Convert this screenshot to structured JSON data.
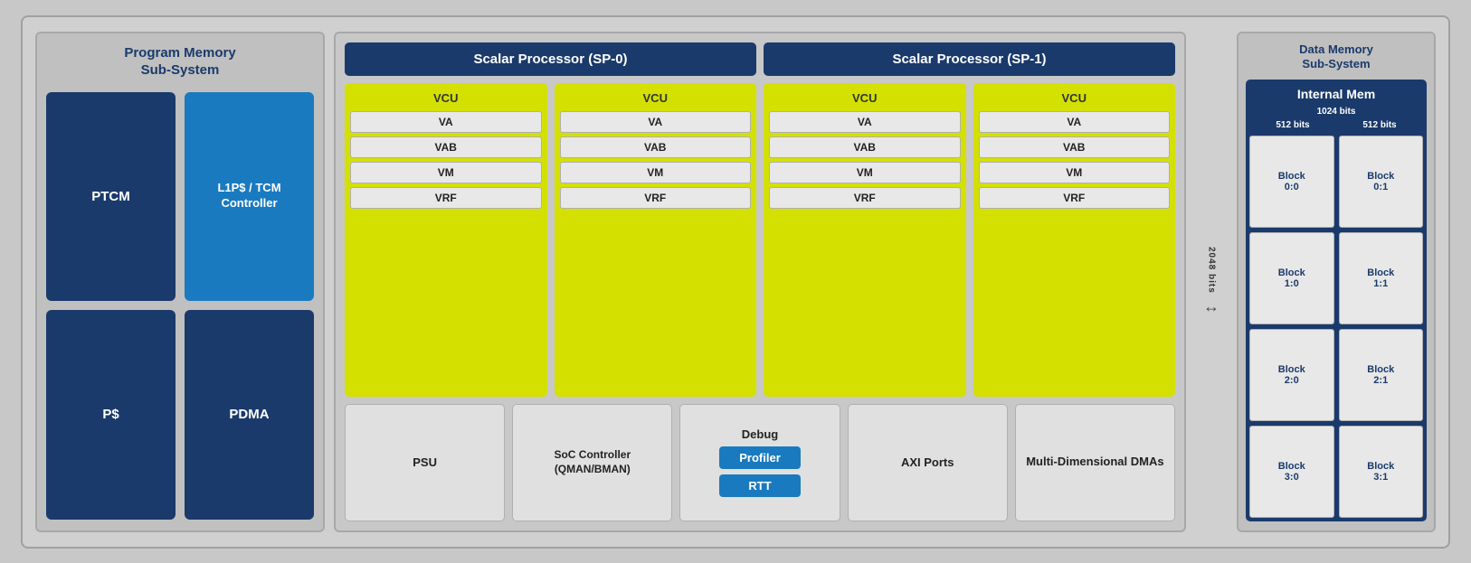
{
  "left": {
    "title": "Program Memory\nSub-System",
    "blocks": [
      {
        "id": "ptcm",
        "label": "PTCM",
        "style": "dark"
      },
      {
        "id": "l1p",
        "label": "L1P$ / TCM Controller",
        "style": "light"
      },
      {
        "id": "ps",
        "label": "P$",
        "style": "dark"
      },
      {
        "id": "pdma",
        "label": "PDMA",
        "style": "dark"
      }
    ]
  },
  "middle": {
    "sp_boxes": [
      {
        "id": "sp0",
        "label": "Scalar Processor (SP-0)"
      },
      {
        "id": "sp1",
        "label": "Scalar Processor (SP-1)"
      }
    ],
    "vcu_units": [
      {
        "id": "vcu1",
        "label": "VCU",
        "sub_blocks": [
          "VA",
          "VAB",
          "VM",
          "VRF"
        ]
      },
      {
        "id": "vcu2",
        "label": "VCU",
        "sub_blocks": [
          "VA",
          "VAB",
          "VM",
          "VRF"
        ]
      },
      {
        "id": "vcu3",
        "label": "VCU",
        "sub_blocks": [
          "VA",
          "VAB",
          "VM",
          "VRF"
        ]
      },
      {
        "id": "vcu4",
        "label": "VCU",
        "sub_blocks": [
          "VA",
          "VAB",
          "VM",
          "VRF"
        ]
      }
    ],
    "bottom_blocks": [
      {
        "id": "psu",
        "label": "PSU"
      },
      {
        "id": "soc",
        "label": "SoC Controller (QMAN/BMAN)"
      },
      {
        "id": "debug",
        "label": "Debug",
        "sub_buttons": [
          "Profiler",
          "RTT"
        ]
      },
      {
        "id": "axi",
        "label": "AXI Ports"
      },
      {
        "id": "dma",
        "label": "Multi-Dimensional DMAs"
      }
    ]
  },
  "arrow": {
    "label": "2048\nbits"
  },
  "right": {
    "title": "Data Memory\nSub-System",
    "internal_mem": {
      "title": "Internal Mem",
      "bits_top": "1024 bits",
      "bits_left": "512 bits",
      "bits_right": "512 bits",
      "blocks": [
        {
          "id": "b00",
          "label": "Block\n0:0"
        },
        {
          "id": "b01",
          "label": "Block\n0:1"
        },
        {
          "id": "b10",
          "label": "Block\n1:0"
        },
        {
          "id": "b11",
          "label": "Block\n1:1"
        },
        {
          "id": "b20",
          "label": "Block\n2:0"
        },
        {
          "id": "b21",
          "label": "Block\n2:1"
        },
        {
          "id": "b30",
          "label": "Block\n3:0"
        },
        {
          "id": "b31",
          "label": "Block\n3:1"
        }
      ]
    }
  }
}
